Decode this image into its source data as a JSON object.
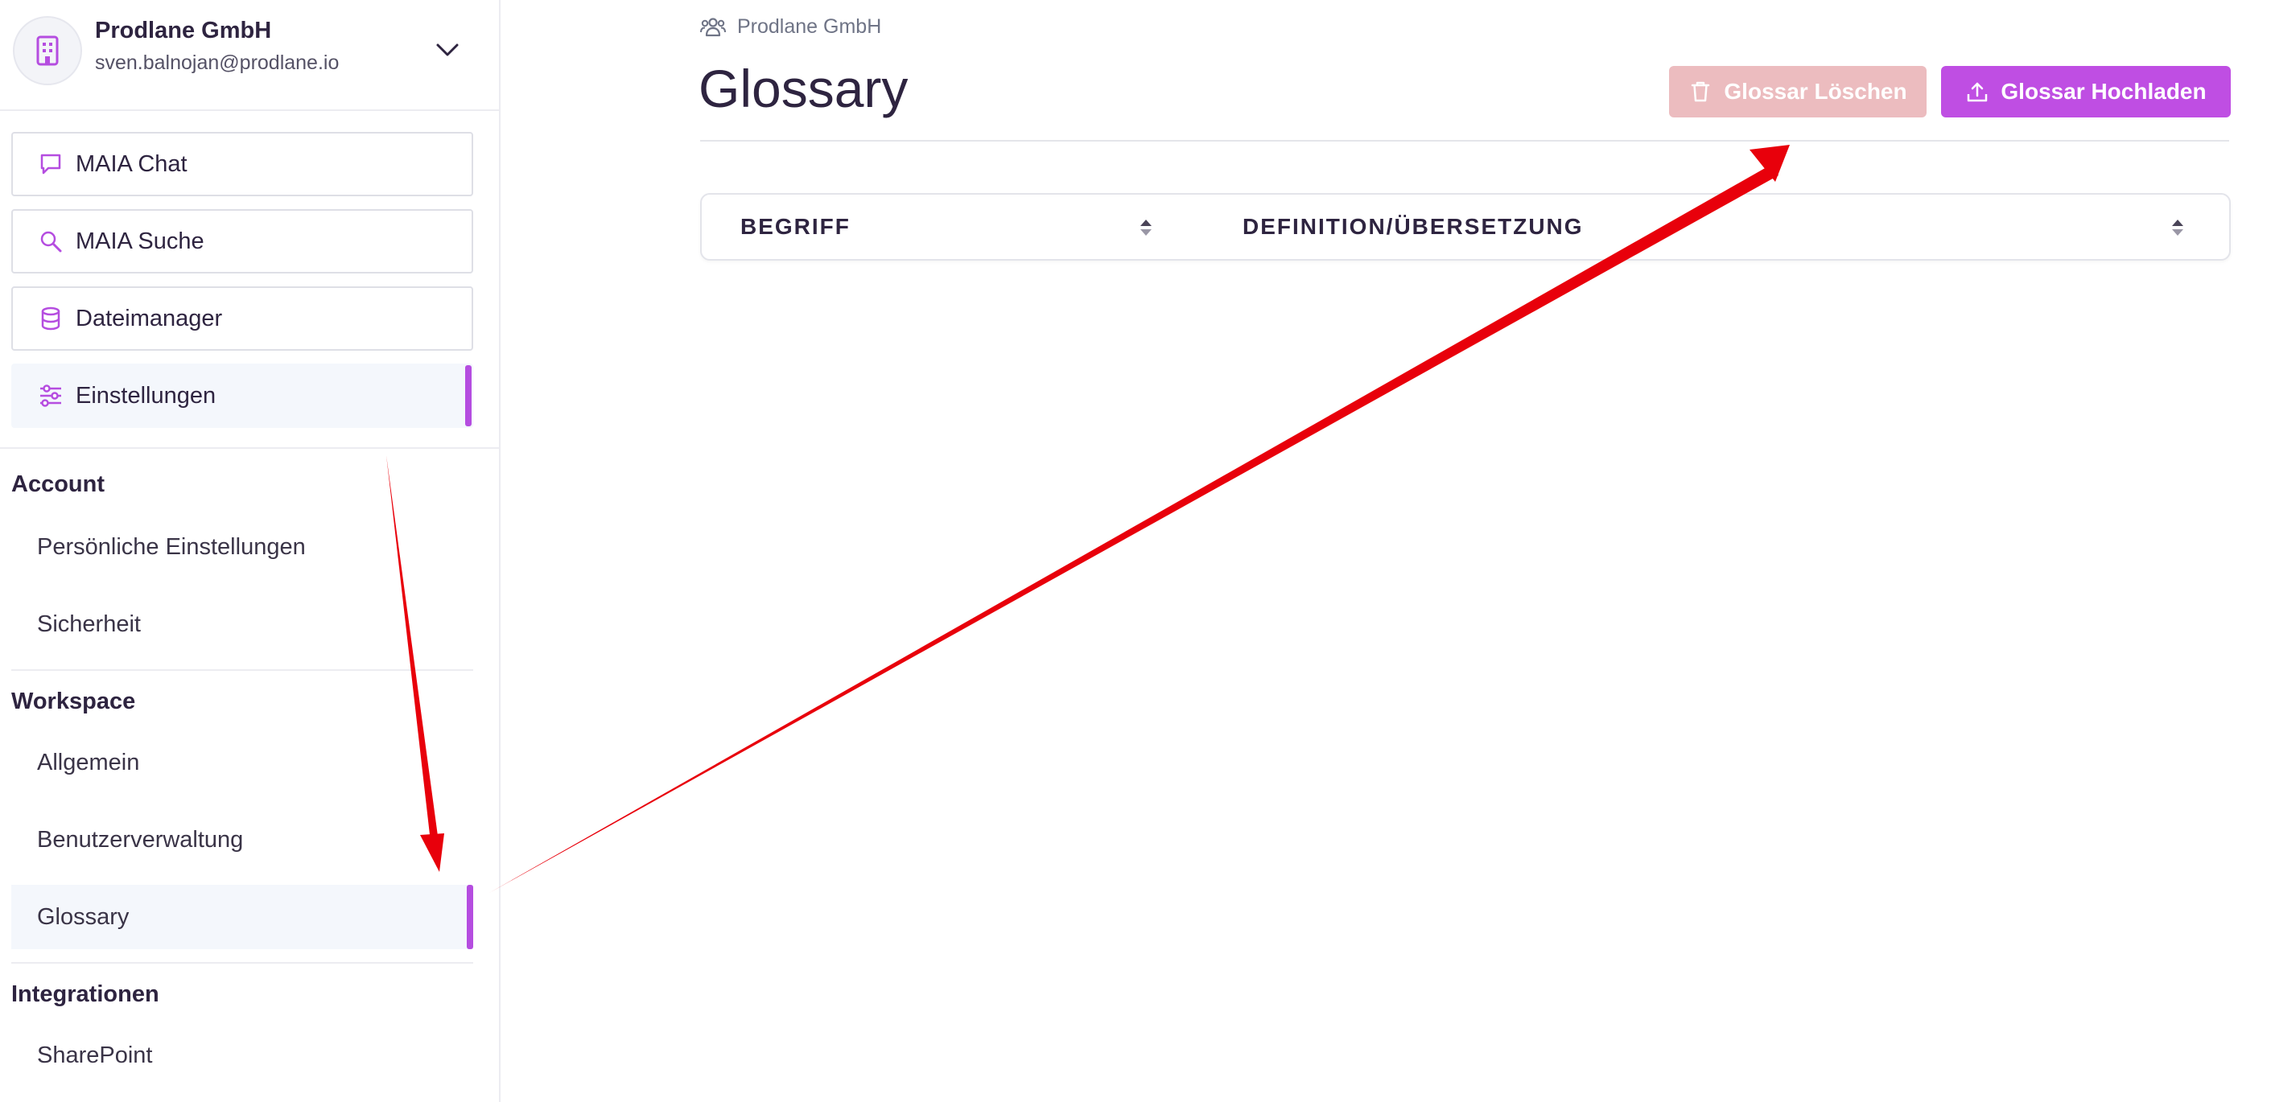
{
  "sidebar": {
    "org": {
      "name": "Prodlane GmbH",
      "email": "sven.balnojan@prodlane.io",
      "avatar_icon": "building-icon",
      "chevron_icon": "chevron-down-icon"
    },
    "nav": [
      {
        "label": "MAIA Chat",
        "icon": "chat-bubble-icon",
        "active": false
      },
      {
        "label": "MAIA Suche",
        "icon": "search-icon",
        "active": false
      },
      {
        "label": "Dateimanager",
        "icon": "database-icon",
        "active": false
      },
      {
        "label": "Einstellungen",
        "icon": "sliders-icon",
        "active": true
      }
    ],
    "sections": [
      {
        "title": "Account",
        "items": [
          {
            "label": "Persönliche Einstellungen"
          },
          {
            "label": "Sicherheit"
          }
        ]
      },
      {
        "title": "Workspace",
        "items": [
          {
            "label": "Allgemein"
          },
          {
            "label": "Benutzerverwaltung"
          },
          {
            "label": "Glossary",
            "active": true
          }
        ]
      },
      {
        "title": "Integrationen",
        "items": [
          {
            "label": "SharePoint"
          }
        ]
      }
    ]
  },
  "main": {
    "breadcrumb": {
      "label": "Prodlane GmbH",
      "icon": "users-icon"
    },
    "title": "Glossary",
    "buttons": {
      "delete": {
        "label": "Glossar Löschen",
        "icon": "trash-icon",
        "disabled": true
      },
      "upload": {
        "label": "Glossar Hochladen",
        "icon": "upload-icon"
      }
    },
    "table": {
      "columns": [
        {
          "label": "BEGRIFF"
        },
        {
          "label": "DEFINITION/ÜBERSETZUNG"
        }
      ],
      "rows": []
    }
  },
  "colors": {
    "accent": "#bf4ee3",
    "accent_bar": "#b54de0",
    "delete_disabled": "#ecbcbf",
    "annotation_arrow": "#e8000b",
    "text": "#2e2440"
  }
}
